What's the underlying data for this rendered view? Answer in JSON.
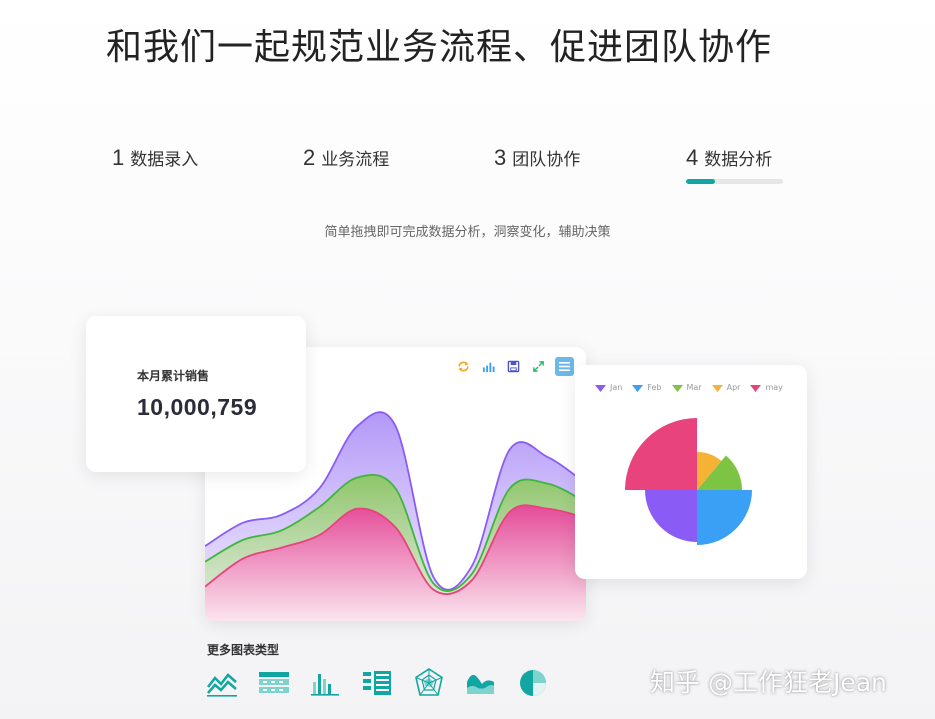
{
  "headline": "和我们一起规范业务流程、促进团队协作",
  "steps": [
    {
      "num": "1",
      "label": "数据录入"
    },
    {
      "num": "2",
      "label": "业务流程"
    },
    {
      "num": "3",
      "label": "团队协作"
    },
    {
      "num": "4",
      "label": "数据分析"
    }
  ],
  "active_step_progress": 0.3,
  "subtitle": "简单拖拽即可完成数据分析，洞察变化，辅助决策",
  "kpi": {
    "label": "本月累计销售",
    "value": "10,000,759"
  },
  "toolbar_icons": [
    "refresh-icon",
    "bar-chart-icon",
    "save-icon",
    "expand-icon",
    "menu-icon"
  ],
  "colors": {
    "accent": "#12a6a2",
    "purple": "#8a5cf5",
    "green": "#7ec444",
    "pink": "#e8437d",
    "blue": "#3aa0f5",
    "orange": "#f5b335"
  },
  "chart_data": [
    {
      "type": "area",
      "x": [
        0,
        1,
        2,
        3,
        4,
        5,
        6,
        7,
        8,
        9,
        10
      ],
      "series": [
        {
          "values": [
            48,
            63,
            68,
            85,
            125,
            125,
            28,
            35,
            110,
            105,
            88
          ]
        },
        {
          "values": [
            38,
            52,
            58,
            73,
            92,
            85,
            24,
            30,
            85,
            88,
            76
          ]
        },
        {
          "values": [
            22,
            40,
            47,
            55,
            72,
            60,
            20,
            26,
            70,
            72,
            66
          ]
        }
      ],
      "ylim": [
        0,
        150
      ]
    },
    {
      "type": "pie",
      "subtype": "rose",
      "legend": [
        "Jan",
        "Feb",
        "Mar",
        "Apr",
        "may"
      ],
      "slices": [
        {
          "name": "Jan",
          "value": 90,
          "radius": 52
        },
        {
          "name": "Feb",
          "value": 90,
          "radius": 55
        },
        {
          "name": "Mar",
          "value": 50,
          "radius": 45
        },
        {
          "name": "Apr",
          "value": 40,
          "radius": 38
        },
        {
          "name": "may",
          "value": 90,
          "radius": 72
        }
      ]
    }
  ],
  "more_charts_title": "更多图表类型",
  "chart_type_icons": [
    "line-chart-icon",
    "table-icon",
    "bar-chart-icon",
    "list-icon",
    "radar-chart-icon",
    "area-chart-icon",
    "pie-chart-icon"
  ],
  "watermark": "知乎 @工作狂老Jean"
}
